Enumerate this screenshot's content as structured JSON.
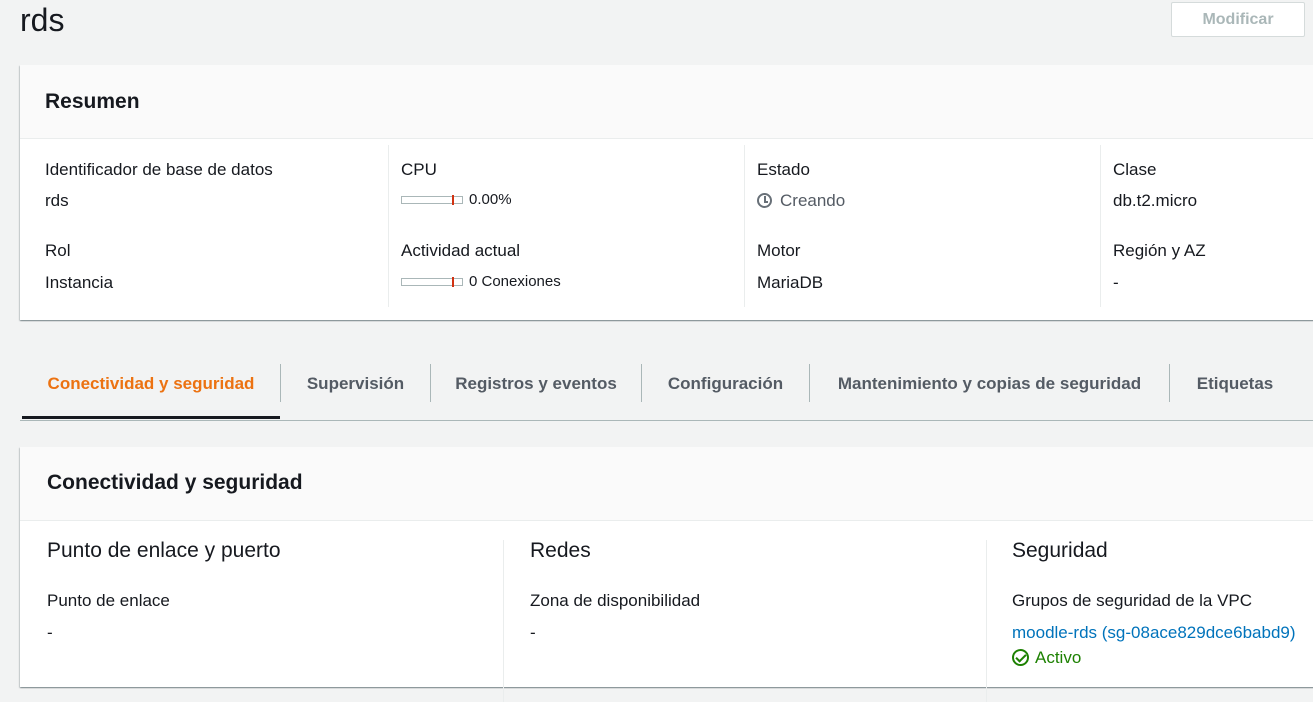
{
  "header": {
    "title": "rds",
    "modify_label": "Modificar"
  },
  "summary": {
    "title": "Resumen",
    "db_id_label": "Identificador de base de datos",
    "db_id_value": "rds",
    "cpu_label": "CPU",
    "cpu_value": "0.00%",
    "status_label": "Estado",
    "status_value": "Creando",
    "class_label": "Clase",
    "class_value": "db.t2.micro",
    "role_label": "Rol",
    "role_value": "Instancia",
    "activity_label": "Actividad actual",
    "activity_value": "0 Conexiones",
    "engine_label": "Motor",
    "engine_value": "MariaDB",
    "region_label": "Región y AZ",
    "region_value": "-"
  },
  "tabs": [
    {
      "label": "Conectividad y seguridad"
    },
    {
      "label": "Supervisión"
    },
    {
      "label": "Registros y eventos"
    },
    {
      "label": "Configuración"
    },
    {
      "label": "Mantenimiento y copias de seguridad"
    },
    {
      "label": "Etiquetas"
    }
  ],
  "connectivity": {
    "title": "Conectividad y seguridad",
    "endpoint_section": "Punto de enlace y puerto",
    "endpoint_label": "Punto de enlace",
    "endpoint_value": "-",
    "network_section": "Redes",
    "az_label": "Zona de disponibilidad",
    "az_value": "-",
    "security_section": "Seguridad",
    "vpc_sg_label": "Grupos de seguridad de la VPC",
    "vpc_sg_link": "moodle-rds (sg-08ace829dce6babd9)",
    "vpc_sg_status": "Activo"
  },
  "icons": {
    "status": "clock-icon",
    "active": "check-circle-icon"
  },
  "colors": {
    "accent": "#ec7211",
    "link": "#0073bb",
    "success": "#1d8102"
  }
}
